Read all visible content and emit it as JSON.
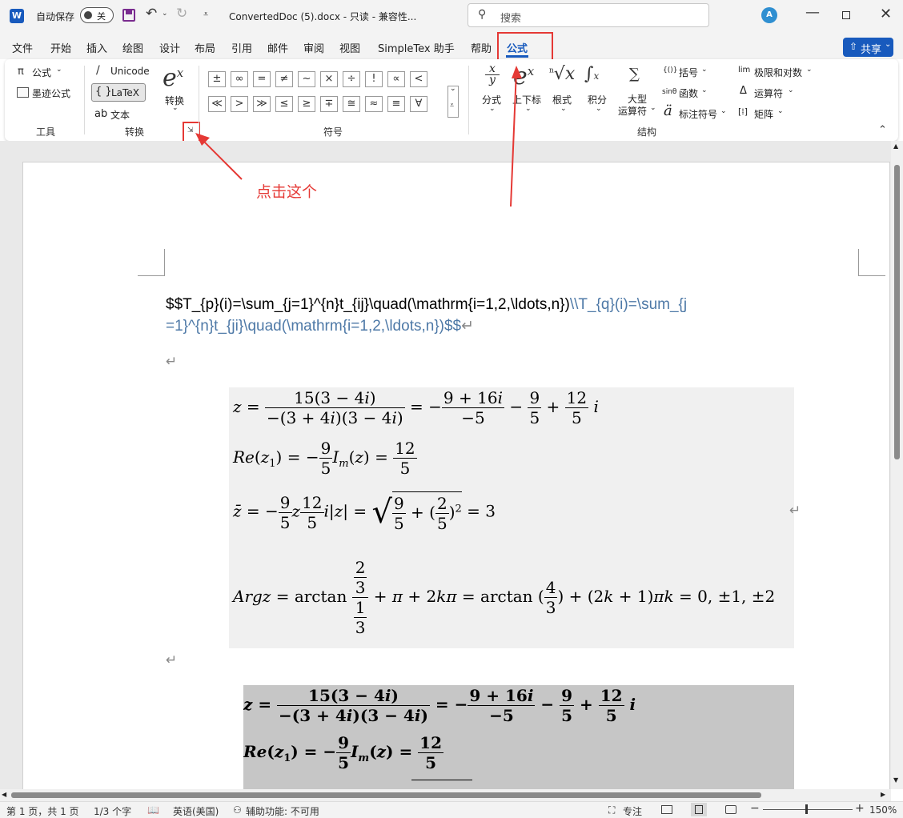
{
  "titlebar": {
    "autosave_label": "自动保存",
    "autosave_state": "关",
    "doc_title": "ConvertedDoc (5).docx  -  只读  -  兼容性...",
    "search_placeholder": "搜索"
  },
  "menu": {
    "items": [
      "文件",
      "开始",
      "插入",
      "绘图",
      "设计",
      "布局",
      "引用",
      "邮件",
      "审阅",
      "视图",
      "SimpleTex 助手",
      "帮助",
      "公式"
    ],
    "share_label": "共享"
  },
  "ribbon": {
    "tools": {
      "equation": "公式",
      "ink_equation": "墨迹公式",
      "label": "工具"
    },
    "convert": {
      "unicode": "Unicode",
      "latex": "LaTeX",
      "text": "文本",
      "convert_btn": "转换",
      "label": "转换"
    },
    "symbols": {
      "row1": [
        "±",
        "∞",
        "=",
        "≠",
        "~",
        "×",
        "÷",
        "!",
        "∝",
        "<"
      ],
      "row2": [
        "≪",
        ">",
        "≫",
        "≤",
        "≥",
        "∓",
        "≅",
        "≈",
        "≡",
        "∀"
      ],
      "label": "符号"
    },
    "structures": {
      "fraction": "分式",
      "script": "上下标",
      "radical": "根式",
      "integral": "积分",
      "large_op_1": "大型",
      "large_op_2": "运算符",
      "bracket": "括号",
      "function": "函数",
      "accent": "标注符号",
      "limit_log": "极限和对数",
      "operator": "运算符",
      "matrix": "矩阵",
      "label": "结构"
    }
  },
  "annotations": {
    "click_this": "点击这个",
    "accent_color": "#e53935"
  },
  "document": {
    "latex_black": "$$T_{p}(i)=\\sum_{j=1}^{n}t_{ij}\\quad(\\mathrm{i=1,2,\\ldots,n})",
    "latex_blue_1": "\\\\T_{q}(i)=\\sum_{j",
    "latex_blue_2": "=1}^{n}t_{ji}\\quad(\\mathrm{i=1,2,\\ldots,n})$$",
    "para_mark": "↵",
    "link_color": "#4e79a7"
  },
  "status": {
    "page": "第 1 页，共 1 页",
    "words": "1/3 个字",
    "language": "英语(美国)",
    "accessibility": "辅助功能: 不可用",
    "focus": "专注",
    "zoom": "150%"
  }
}
